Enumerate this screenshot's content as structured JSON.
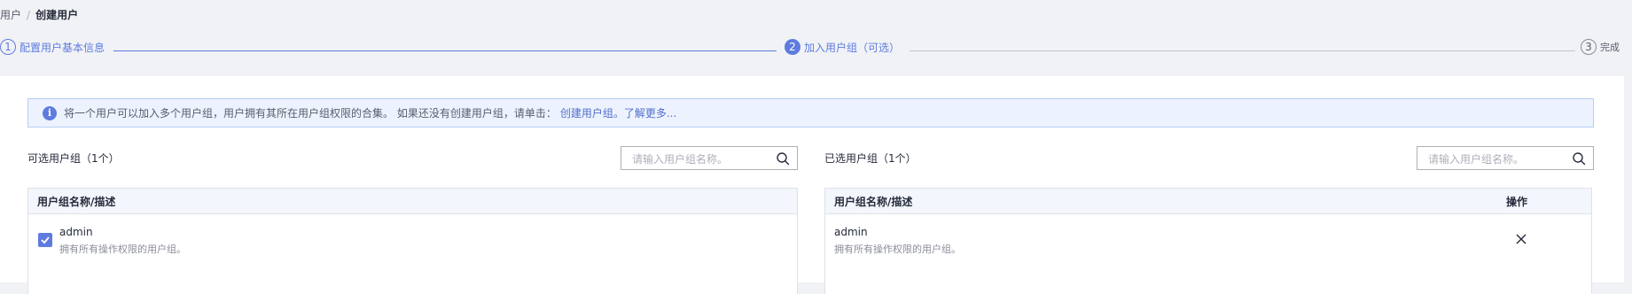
{
  "breadcrumb": {
    "parent": "用户",
    "separator": "/",
    "current": "创建用户"
  },
  "steps": [
    {
      "num": "1",
      "label": "配置用户基本信息"
    },
    {
      "num": "2",
      "label": "加入用户组（可选）"
    },
    {
      "num": "3",
      "label": "完成"
    }
  ],
  "info": {
    "text": "将一个用户可以加入多个用户组，用户拥有其所在用户组权限的合集。 如果还没有创建用户组，请单击：",
    "link_create": "创建用户组。",
    "link_more": "了解更多...",
    "icon": "info-icon"
  },
  "available": {
    "title": "可选用户组（1个）",
    "search_placeholder": "请输入用户组名称。",
    "header": "用户组名称/描述",
    "rows": [
      {
        "name": "admin",
        "desc": "拥有所有操作权限的用户组。",
        "checked": true
      }
    ]
  },
  "selected": {
    "title": "已选用户组（1个）",
    "search_placeholder": "请输入用户组名称。",
    "header": "用户组名称/描述",
    "header_action": "操作",
    "rows": [
      {
        "name": "admin",
        "desc": "拥有所有操作权限的用户组。"
      }
    ]
  },
  "colors": {
    "accent": "#5e7ce0",
    "link": "#526ecc",
    "info_bg": "#edf3fe"
  }
}
